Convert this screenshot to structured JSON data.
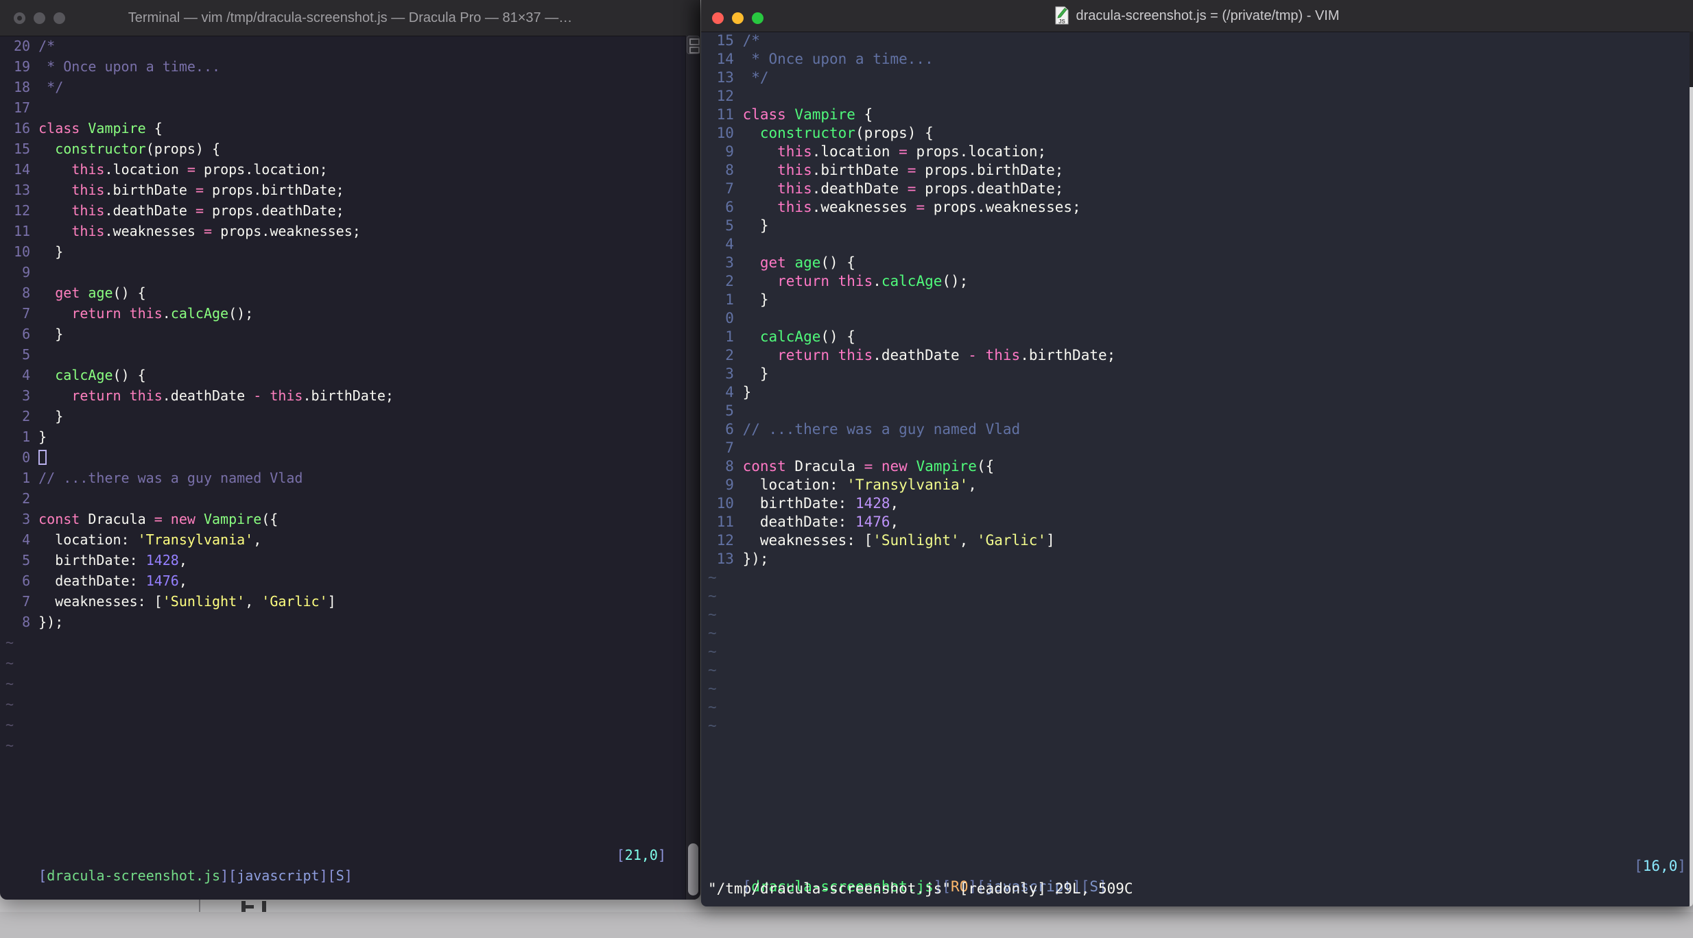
{
  "desktop": {
    "strip_color": "#c7c6c8"
  },
  "left_window": {
    "title": "Terminal — vim /tmp/dracula-screenshot.js — Dracula Pro — 81×37 —…",
    "focused": false,
    "theme": {
      "bg": "#201f2a",
      "f": "#f8f8f2",
      "c": "#7970a9",
      "p": "#ff80bf",
      "g": "#8aff80",
      "y": "#ffff80",
      "n": "#9580ff",
      "gutter": "#7970a9",
      "tilde": "#554f68"
    },
    "status_palette": {
      "br": "#8f95dc",
      "file": "#74dd88",
      "word": "#8f9fe0",
      "ro": "#ffca80",
      "loc": "#80ffea"
    },
    "rel_numbers": [
      20,
      19,
      18,
      17,
      16,
      15,
      14,
      13,
      12,
      11,
      10,
      9,
      8,
      7,
      6,
      5,
      4,
      3,
      2,
      1,
      0,
      1,
      2,
      3,
      4,
      5,
      6,
      7,
      8
    ],
    "cursor_line": 21,
    "cursor_style": "hollow",
    "tilde_char": "~",
    "tilde_count": 6,
    "status": {
      "left": [
        [
          "br",
          "["
        ],
        [
          "file",
          "dracula-screenshot.js"
        ],
        [
          "br",
          "]["
        ],
        [
          "word",
          "javascript"
        ],
        [
          "br",
          "]["
        ],
        [
          "word",
          "S"
        ],
        [
          "br",
          "]"
        ]
      ],
      "right": [
        [
          "br",
          "["
        ],
        [
          "loc",
          "21,0"
        ],
        [
          "br",
          "]"
        ]
      ]
    }
  },
  "right_window": {
    "title": "dracula-screenshot.js = (/private/tmp) - VIM",
    "focused": true,
    "proxy_icon_label": "JS",
    "theme": {
      "bg": "#272934",
      "f": "#f8f8f2",
      "c": "#6272a4",
      "p": "#ff79c6",
      "g": "#50fa7b",
      "y": "#f1fa8c",
      "n": "#bd93f9",
      "gutter": "#6272a4",
      "tilde": "#4a546e"
    },
    "status_palette": {
      "br": "#6c7bb0",
      "file": "#50fa7b",
      "word": "#7e93c8",
      "ro": "#ffb86c",
      "loc": "#8be9fd"
    },
    "rel_numbers": [
      15,
      14,
      13,
      12,
      11,
      10,
      9,
      8,
      7,
      6,
      5,
      4,
      3,
      2,
      1,
      0,
      1,
      2,
      3,
      4,
      5,
      6,
      7,
      8,
      9,
      10,
      11,
      12,
      13
    ],
    "cursor_line": 16,
    "cursor_style": "none",
    "tilde_char": "~",
    "tilde_count": 9,
    "status": {
      "left": [
        [
          "br",
          "["
        ],
        [
          "file",
          "dracula-screenshot.js"
        ],
        [
          "br",
          "]["
        ],
        [
          "ro",
          "RO"
        ],
        [
          "br",
          "]["
        ],
        [
          "word",
          "javascript"
        ],
        [
          "br",
          "]["
        ],
        [
          "word",
          "S"
        ],
        [
          "br",
          "]"
        ]
      ],
      "right": [
        [
          "br",
          "["
        ],
        [
          "loc",
          "16,0"
        ],
        [
          "br",
          "]"
        ]
      ]
    },
    "cmdline": "\"/tmp/dracula-screenshot.js\" [readonly] 29L, 509C"
  },
  "code_lines": [
    [
      [
        "c",
        "/*"
      ]
    ],
    [
      [
        "c",
        " * Once upon a time..."
      ]
    ],
    [
      [
        "c",
        " */"
      ]
    ],
    [],
    [
      [
        "p",
        "class "
      ],
      [
        "g",
        "Vampire"
      ],
      [
        "f",
        " {"
      ]
    ],
    [
      [
        "f",
        "  "
      ],
      [
        "g",
        "constructor"
      ],
      [
        "f",
        "(props) {"
      ]
    ],
    [
      [
        "f",
        "    "
      ],
      [
        "p",
        "this"
      ],
      [
        "f",
        ".location "
      ],
      [
        "p",
        "="
      ],
      [
        "f",
        " props.location;"
      ]
    ],
    [
      [
        "f",
        "    "
      ],
      [
        "p",
        "this"
      ],
      [
        "f",
        ".birthDate "
      ],
      [
        "p",
        "="
      ],
      [
        "f",
        " props.birthDate;"
      ]
    ],
    [
      [
        "f",
        "    "
      ],
      [
        "p",
        "this"
      ],
      [
        "f",
        ".deathDate "
      ],
      [
        "p",
        "="
      ],
      [
        "f",
        " props.deathDate;"
      ]
    ],
    [
      [
        "f",
        "    "
      ],
      [
        "p",
        "this"
      ],
      [
        "f",
        ".weaknesses "
      ],
      [
        "p",
        "="
      ],
      [
        "f",
        " props.weaknesses;"
      ]
    ],
    [
      [
        "f",
        "  }"
      ]
    ],
    [],
    [
      [
        "f",
        "  "
      ],
      [
        "p",
        "get "
      ],
      [
        "g",
        "age"
      ],
      [
        "f",
        "() {"
      ]
    ],
    [
      [
        "f",
        "    "
      ],
      [
        "p",
        "return this"
      ],
      [
        "f",
        "."
      ],
      [
        "g",
        "calcAge"
      ],
      [
        "f",
        "();"
      ]
    ],
    [
      [
        "f",
        "  }"
      ]
    ],
    [],
    [
      [
        "f",
        "  "
      ],
      [
        "g",
        "calcAge"
      ],
      [
        "f",
        "() {"
      ]
    ],
    [
      [
        "f",
        "    "
      ],
      [
        "p",
        "return this"
      ],
      [
        "f",
        ".deathDate "
      ],
      [
        "p",
        "-"
      ],
      [
        "f",
        " "
      ],
      [
        "p",
        "this"
      ],
      [
        "f",
        ".birthDate;"
      ]
    ],
    [
      [
        "f",
        "  }"
      ]
    ],
    [
      [
        "f",
        "}"
      ]
    ],
    [],
    [
      [
        "c",
        "// ...there was a guy named Vlad"
      ]
    ],
    [],
    [
      [
        "p",
        "const "
      ],
      [
        "f",
        "Dracula "
      ],
      [
        "p",
        "= new "
      ],
      [
        "g",
        "Vampire"
      ],
      [
        "f",
        "({"
      ]
    ],
    [
      [
        "f",
        "  location: "
      ],
      [
        "y",
        "'Transylvania'"
      ],
      [
        "f",
        ","
      ]
    ],
    [
      [
        "f",
        "  birthDate: "
      ],
      [
        "n",
        "1428"
      ],
      [
        "f",
        ","
      ]
    ],
    [
      [
        "f",
        "  deathDate: "
      ],
      [
        "n",
        "1476"
      ],
      [
        "f",
        ","
      ]
    ],
    [
      [
        "f",
        "  weaknesses: ["
      ],
      [
        "y",
        "'Sunlight'"
      ],
      [
        "f",
        ", "
      ],
      [
        "y",
        "'Garlic'"
      ],
      [
        "f",
        "]"
      ]
    ],
    [
      [
        "f",
        "});"
      ]
    ]
  ]
}
